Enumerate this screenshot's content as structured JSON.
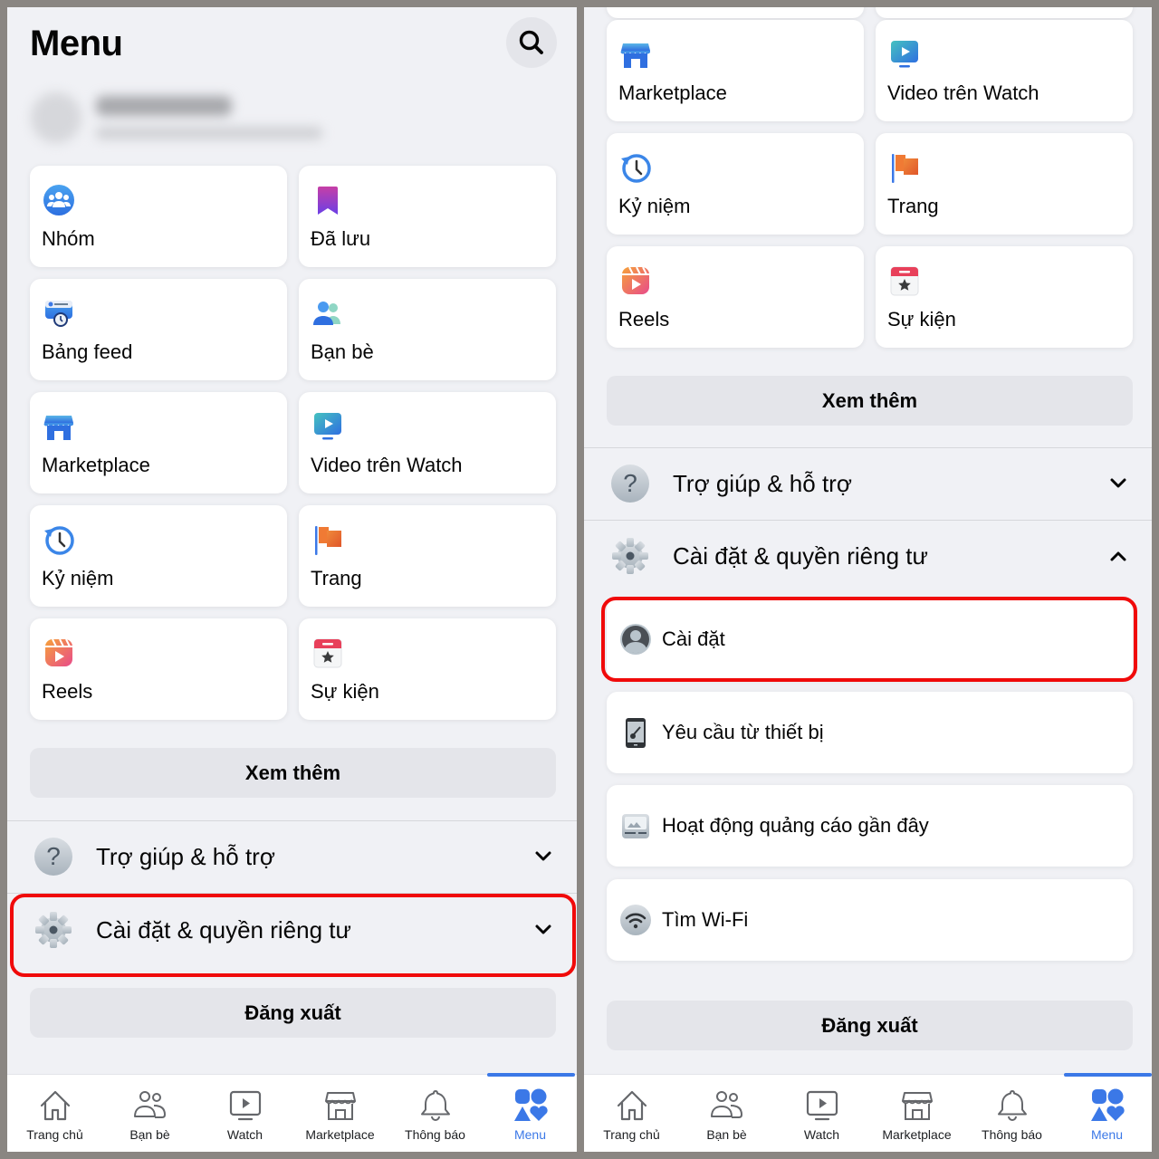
{
  "left": {
    "title": "Menu",
    "profile": {
      "name": "(blurred)",
      "subtitle": "(blurred)"
    },
    "shortcuts": [
      {
        "label": "Nhóm",
        "icon": "groups-icon"
      },
      {
        "label": "Đã lưu",
        "icon": "saved-bookmark-icon"
      },
      {
        "label": "Bảng feed",
        "icon": "feeds-icon"
      },
      {
        "label": "Bạn bè",
        "icon": "friends-icon"
      },
      {
        "label": "Marketplace",
        "icon": "marketplace-store-icon"
      },
      {
        "label": "Video trên Watch",
        "icon": "watch-video-icon"
      },
      {
        "label": "Kỷ niệm",
        "icon": "memories-clock-icon"
      },
      {
        "label": "Trang",
        "icon": "pages-flag-icon"
      },
      {
        "label": "Reels",
        "icon": "reels-icon"
      },
      {
        "label": "Sự kiện",
        "icon": "events-calendar-icon"
      }
    ],
    "see_more": "Xem thêm",
    "help_section": "Trợ giúp & hỗ trợ",
    "settings_section": "Cài đặt & quyền riêng tư",
    "logout": "Đăng xuất"
  },
  "right": {
    "shortcuts": [
      {
        "label": "Marketplace",
        "icon": "marketplace-store-icon"
      },
      {
        "label": "Video trên Watch",
        "icon": "watch-video-icon"
      },
      {
        "label": "Kỷ niệm",
        "icon": "memories-clock-icon"
      },
      {
        "label": "Trang",
        "icon": "pages-flag-icon"
      },
      {
        "label": "Reels",
        "icon": "reels-icon"
      },
      {
        "label": "Sự kiện",
        "icon": "events-calendar-icon"
      }
    ],
    "see_more": "Xem thêm",
    "help_section": "Trợ giúp & hỗ trợ",
    "settings_section": "Cài đặt & quyền riêng tư",
    "settings_items": [
      {
        "label": "Cài đặt",
        "icon": "settings-profile-icon"
      },
      {
        "label": "Yêu cầu từ thiết bị",
        "icon": "device-requests-icon"
      },
      {
        "label": "Hoạt động quảng cáo gần đây",
        "icon": "recent-ad-activity-icon"
      },
      {
        "label": "Tìm Wi-Fi",
        "icon": "wifi-icon"
      }
    ],
    "logout": "Đăng xuất"
  },
  "navbar": {
    "items": [
      {
        "label": "Trang chủ",
        "icon": "home-icon"
      },
      {
        "label": "Bạn bè",
        "icon": "friends-outline-icon"
      },
      {
        "label": "Watch",
        "icon": "watch-outline-icon"
      },
      {
        "label": "Marketplace",
        "icon": "marketplace-outline-icon"
      },
      {
        "label": "Thông báo",
        "icon": "bell-icon"
      },
      {
        "label": "Menu",
        "icon": "menu-shapes-icon"
      }
    ],
    "active": "Menu"
  },
  "colors": {
    "accent": "#3b78e7",
    "highlight": "#f00a0a",
    "background": "#f0f1f5",
    "card": "#ffffff",
    "button_gray": "#e4e5ea"
  }
}
